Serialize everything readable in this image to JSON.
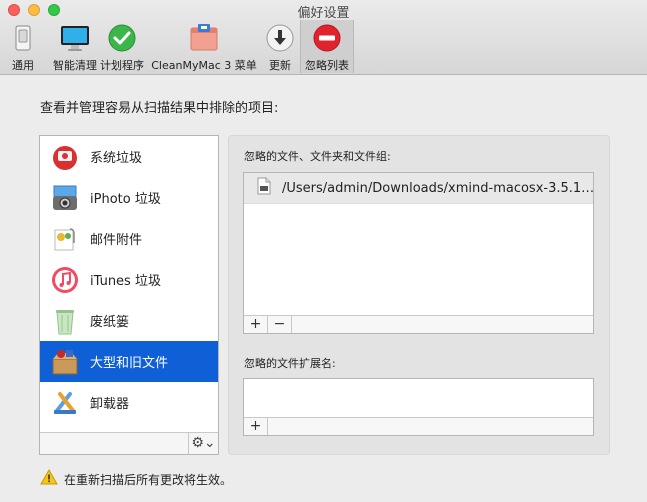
{
  "window": {
    "title": "偏好设置"
  },
  "toolbar": {
    "items": [
      {
        "label": "通用",
        "icon": "general-switch-icon"
      },
      {
        "label": "智能清理",
        "icon": "monitor-icon"
      },
      {
        "label": "计划程序",
        "icon": "check-circle-icon"
      },
      {
        "label": "CleanMyMac 3 菜单",
        "icon": "menu-bar-icon"
      },
      {
        "label": "更新",
        "icon": "download-arrow-icon"
      },
      {
        "label": "忽略列表",
        "icon": "no-entry-icon",
        "active": true
      }
    ]
  },
  "main": {
    "heading": "查看并管理容易从扫描结果中排除的项目:"
  },
  "categories": {
    "items": [
      {
        "label": "系统垃圾",
        "icon": "system-junk-icon"
      },
      {
        "label": "iPhoto 垃圾",
        "icon": "iphoto-icon"
      },
      {
        "label": "邮件附件",
        "icon": "mail-attachment-icon"
      },
      {
        "label": "iTunes 垃圾",
        "icon": "itunes-icon"
      },
      {
        "label": "废纸篓",
        "icon": "trash-icon"
      },
      {
        "label": "大型和旧文件",
        "icon": "large-files-icon",
        "selected": true
      },
      {
        "label": "卸载器",
        "icon": "uninstaller-icon"
      }
    ],
    "gear_label": "⚙︎⌄"
  },
  "ignored_files": {
    "label": "忽略的文件、文件夹和文件组:",
    "rows": [
      "/Users/admin/Downloads/xmind-macosx-3.5.1…"
    ],
    "add_label": "+",
    "remove_label": "−"
  },
  "ignored_extensions": {
    "label": "忽略的文件扩展名:",
    "add_label": "+"
  },
  "notice": {
    "text": "在重新扫描后所有更改将生效。"
  },
  "colors": {
    "selection": "#0f60d7",
    "close": "#fc605c",
    "minimize": "#fdbc40",
    "maximize": "#34c84a"
  }
}
